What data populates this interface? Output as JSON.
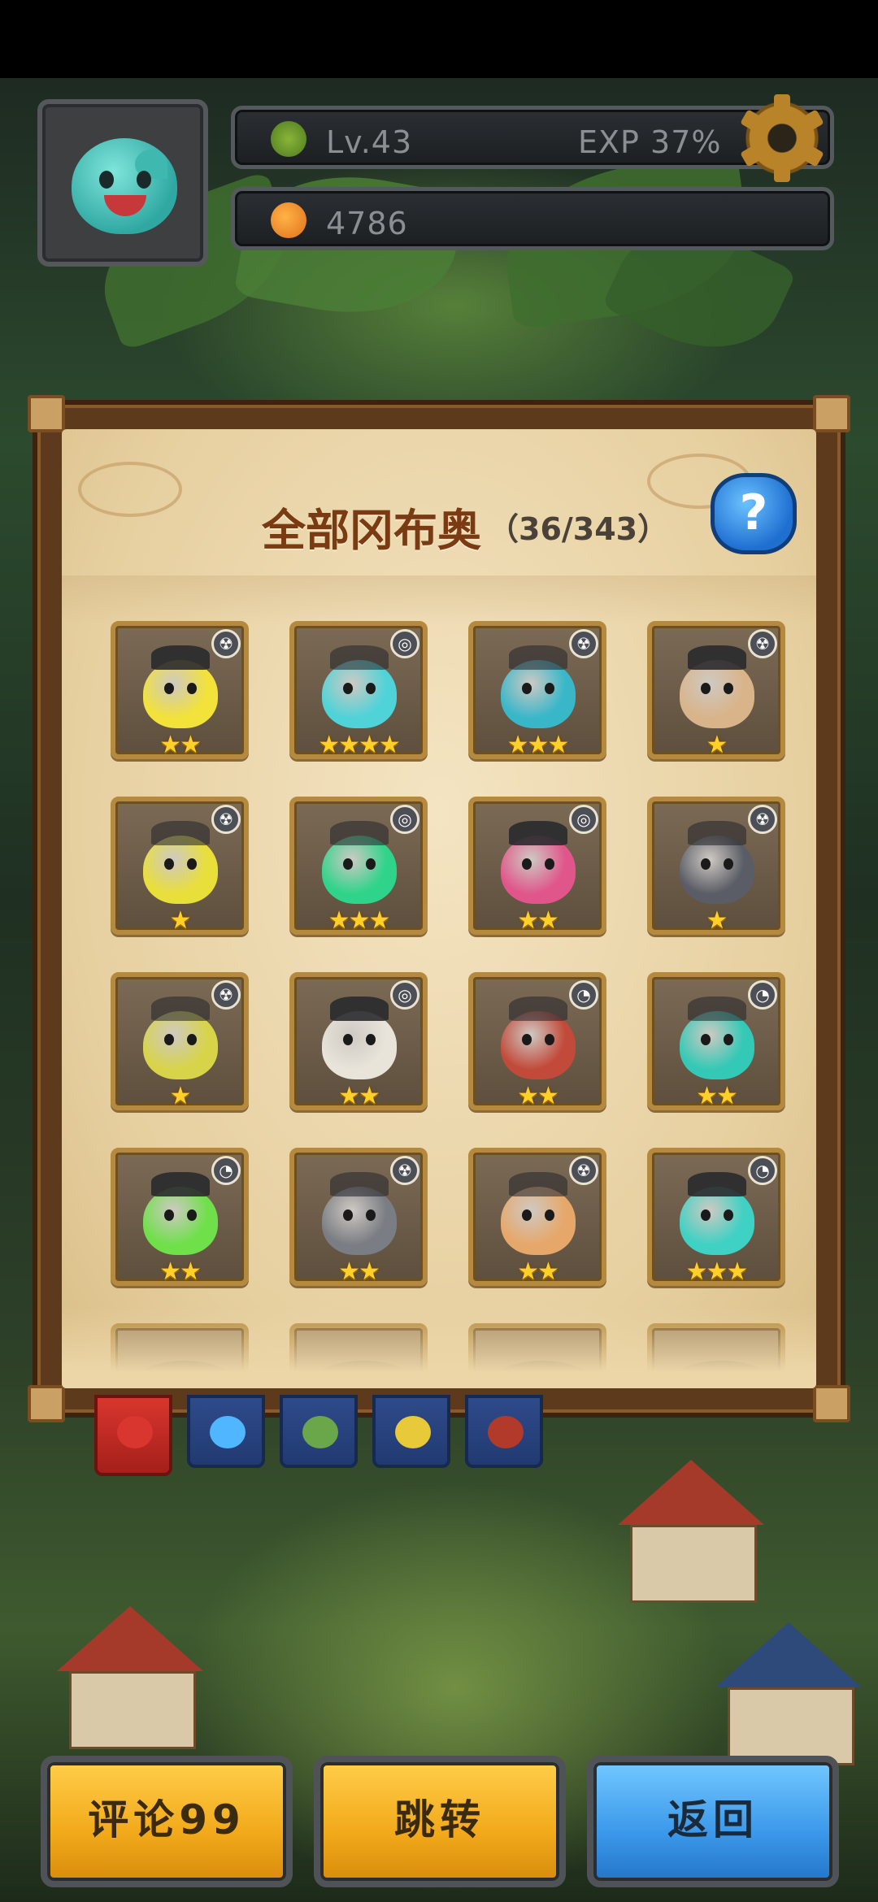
{
  "hud": {
    "level_label": "Lv.43",
    "exp_label": "EXP 37%",
    "coins": "4786",
    "avatar_icon": "teal-blob-avatar-icon",
    "settings_icon": "gear-icon"
  },
  "collection": {
    "title": "全部冈布奥",
    "count": "（36/343）",
    "help_label": "?",
    "cards": [
      {
        "stars": "★★",
        "element": "☢",
        "color": "#f2e23a"
      },
      {
        "stars": "★★★★",
        "element": "◎",
        "color": "#4fd3d8"
      },
      {
        "stars": "★★★",
        "element": "☢",
        "color": "#39b7c9"
      },
      {
        "stars": "★",
        "element": "☢",
        "color": "#d9b48a"
      },
      {
        "stars": "★",
        "element": "☢",
        "color": "#e9df3a"
      },
      {
        "stars": "★★★",
        "element": "◎",
        "color": "#2fd48a"
      },
      {
        "stars": "★★",
        "element": "◎",
        "color": "#e0568a"
      },
      {
        "stars": "★",
        "element": "☢",
        "color": "#5a5d66"
      },
      {
        "stars": "★",
        "element": "☢",
        "color": "#d8d44a"
      },
      {
        "stars": "★★",
        "element": "◎",
        "color": "#e8e4da"
      },
      {
        "stars": "★★",
        "element": "◔",
        "color": "#c24a3a"
      },
      {
        "stars": "★★",
        "element": "◔",
        "color": "#34c9b6"
      },
      {
        "stars": "★★",
        "element": "◔",
        "color": "#6fe04a"
      },
      {
        "stars": "★★",
        "element": "☢",
        "color": "#7a7d83"
      },
      {
        "stars": "★★",
        "element": "☢",
        "color": "#e6a86a"
      },
      {
        "stars": "★★★",
        "element": "◔",
        "color": "#3fd1c3"
      }
    ]
  },
  "tabs": [
    {
      "name": "all",
      "color": "#d8362e"
    },
    {
      "name": "blue",
      "color": "#4fb6ff"
    },
    {
      "name": "green",
      "color": "#6aa64a"
    },
    {
      "name": "yellow",
      "color": "#e8c93a"
    },
    {
      "name": "red",
      "color": "#b23a2a"
    }
  ],
  "buttons": {
    "comment": "评论99",
    "jump": "跳转",
    "back": "返回"
  }
}
